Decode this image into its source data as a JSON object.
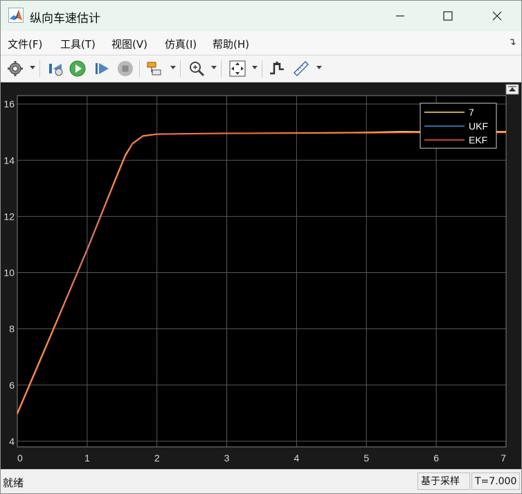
{
  "window": {
    "title": "纵向车速估计"
  },
  "menu": [
    {
      "label": "文件(F)"
    },
    {
      "label": "工具(T)"
    },
    {
      "label": "视图(V)"
    },
    {
      "label": "仿真(I)"
    },
    {
      "label": "帮助(H)"
    }
  ],
  "toolbar": {
    "icons": [
      "settings-icon",
      "step-back-icon",
      "run-icon",
      "step-forward-icon",
      "stop-icon",
      "highlight-simulink-block-icon",
      "zoom-in-icon",
      "fit-to-view-icon",
      "triggers-icon",
      "measurements-icon"
    ]
  },
  "colors": {
    "background": "#000000",
    "series_7": "#ffe14a",
    "series_ukf": "#3d8fe0",
    "series_ekf": "#ff5a3c",
    "grid": "#5a5a5a",
    "axis_text": "#d9d9d9"
  },
  "chart_data": {
    "type": "line",
    "xlim": [
      0,
      7
    ],
    "ylim": [
      3.8,
      16.3
    ],
    "xticks": [
      "0",
      "1",
      "2",
      "3",
      "4",
      "5",
      "6",
      "7"
    ],
    "yticks": [
      "4",
      "6",
      "8",
      "10",
      "12",
      "14",
      "16"
    ],
    "grid": true,
    "legend_position": "top-right",
    "series": [
      {
        "name": "7",
        "x": [
          0,
          0.5,
          1.0,
          1.4,
          1.55,
          1.65,
          1.8,
          2.0,
          2.5,
          3,
          4,
          5,
          5.5,
          6,
          7
        ],
        "y": [
          5.0,
          7.9,
          10.8,
          13.3,
          14.2,
          14.6,
          14.87,
          14.93,
          14.95,
          14.96,
          14.97,
          14.99,
          15.02,
          15.01,
          15.02
        ]
      },
      {
        "name": "UKF",
        "x": [
          0,
          0.5,
          1.0,
          1.4,
          1.55,
          1.65,
          1.8,
          2.0,
          2.5,
          3,
          4,
          5,
          5.5,
          6,
          7
        ],
        "y": [
          5.0,
          7.9,
          10.85,
          13.3,
          14.2,
          14.6,
          14.86,
          14.93,
          14.95,
          14.96,
          14.97,
          14.98,
          15.0,
          15.0,
          15.0
        ]
      },
      {
        "name": "EKF",
        "x": [
          0,
          0.5,
          1.0,
          1.4,
          1.55,
          1.65,
          1.8,
          2.0,
          2.5,
          3,
          4,
          5,
          5.5,
          6,
          7
        ],
        "y": [
          4.95,
          7.85,
          10.8,
          13.25,
          14.15,
          14.58,
          14.85,
          14.92,
          14.94,
          14.95,
          14.96,
          14.97,
          14.98,
          14.98,
          14.98
        ]
      }
    ]
  },
  "status": {
    "left": "就绪",
    "mode": "基于采样",
    "time": "T=7.000"
  }
}
